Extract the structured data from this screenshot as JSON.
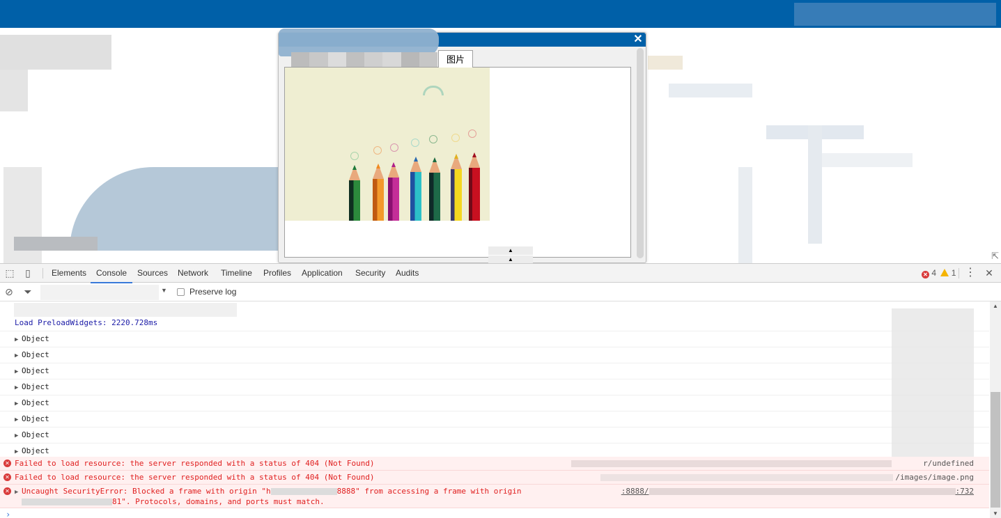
{
  "dialog": {
    "close_glyph": "✕",
    "tab_label": "图片",
    "splitter_up_glyph": "▲",
    "splitter_down_glyph": "▲",
    "resize_glyph": "⇱"
  },
  "devtools": {
    "tabs": [
      {
        "label": "Elements",
        "active": false
      },
      {
        "label": "Console",
        "active": true
      },
      {
        "label": "Sources",
        "active": false
      },
      {
        "label": "Network",
        "active": false
      },
      {
        "label": "Timeline",
        "active": false
      },
      {
        "label": "Profiles",
        "active": false
      },
      {
        "label": "Application",
        "active": false
      },
      {
        "label": "Security",
        "active": false
      },
      {
        "label": "Audits",
        "active": false
      }
    ],
    "error_count": "4",
    "warning_count": "1",
    "menu_glyph": "⋮",
    "close_glyph": "✕",
    "toolbar": {
      "clear_glyph": "⊘",
      "filter_glyph": "⏷",
      "context_arrow": "▼",
      "preserve_log_label": "Preserve log",
      "preserve_log_checked": false
    },
    "console": {
      "info_message": "Load PreloadWidgets: 2220.728ms",
      "objects": [
        "Object",
        "Object",
        "Object",
        "Object",
        "Object",
        "Object",
        "Object",
        "Object"
      ],
      "errors": [
        {
          "message": "Failed to load resource: the server responded with a status of 404 (Not Found)",
          "source_suffix": "r/undefined",
          "expandable": false
        },
        {
          "message": "Failed to load resource: the server responded with a status of 404 (Not Found)",
          "source_suffix": "/images/image.png",
          "expandable": false
        },
        {
          "message_part1": "Uncaught SecurityError: Blocked a frame with origin \"h",
          "message_part2": "8888\" from accessing a frame with origin",
          "message_line2_suffix": "81\". Protocols, domains, and ports must match.",
          "source_prefix": ":8888/",
          "source_suffix": ":732",
          "expandable": true
        }
      ],
      "prompt_glyph": "›"
    }
  },
  "colors": {
    "brand_blue": "#0060a8",
    "error_red": "#d93b3b",
    "warning_yellow": "#f5b400",
    "active_tab_underline": "#3879d9",
    "info_text": "#1a1aa6"
  }
}
